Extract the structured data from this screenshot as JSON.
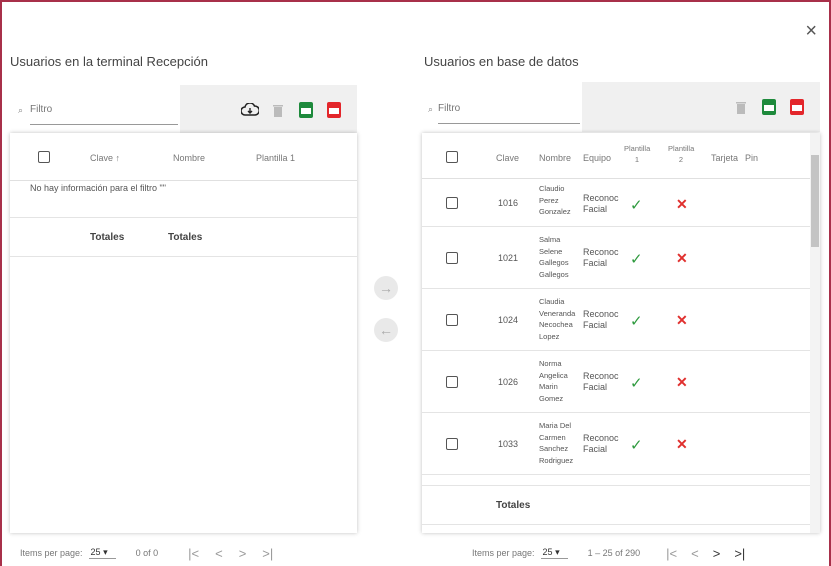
{
  "dialog": {
    "close_label": "×"
  },
  "left": {
    "title": "Usuarios en la terminal Recepción",
    "filter_placeholder": "Filtro",
    "columns": {
      "clave": "Clave ↑",
      "nombre": "Nombre",
      "plantilla1": "Plantilla 1"
    },
    "empty_message": "No hay información para el filtro \"\"",
    "totals": [
      "Totales",
      "Totales"
    ],
    "footer": {
      "items_per_page_label": "Items per page:",
      "page_size": "25",
      "range": "0 of 0"
    }
  },
  "transfer": {
    "right_arrow": "→",
    "left_arrow": "←"
  },
  "right": {
    "title": "Usuarios en base de datos",
    "filter_placeholder": "Filtro",
    "columns": {
      "clave": "Clave",
      "nombre": "Nombre",
      "equipo": "Equipo",
      "plantilla1": "Plantilla 1",
      "plantilla2": "Plantilla 2",
      "tarjeta": "Tarjeta",
      "pin": "Pin"
    },
    "rows": [
      {
        "clave": "1016",
        "nombre": [
          "Claudio",
          "Perez",
          "Gonzalez"
        ],
        "equipo": [
          "Reconoc",
          "Facial"
        ],
        "plantilla1": "✓",
        "plantilla2": "✕"
      },
      {
        "clave": "1021",
        "nombre": [
          "Salma",
          "Selene",
          "Gallegos",
          "Gallegos"
        ],
        "equipo": [
          "Reconoc",
          "Facial"
        ],
        "plantilla1": "✓",
        "plantilla2": "✕"
      },
      {
        "clave": "1024",
        "nombre": [
          "Claudia",
          "Veneranda",
          "Necochea",
          "Lopez"
        ],
        "equipo": [
          "Reconoc",
          "Facial"
        ],
        "plantilla1": "✓",
        "plantilla2": "✕"
      },
      {
        "clave": "1026",
        "nombre": [
          "Norma",
          "Angelica",
          "Marin",
          "Gomez"
        ],
        "equipo": [
          "Reconoc",
          "Facial"
        ],
        "plantilla1": "✓",
        "plantilla2": "✕"
      },
      {
        "clave": "1033",
        "nombre": [
          "Maria Del",
          "Carmen",
          "Sanchez",
          "Rodriguez"
        ],
        "equipo": [
          "Reconoc",
          "Facial"
        ],
        "plantilla1": "✓",
        "plantilla2": "✕"
      }
    ],
    "totals": "Totales",
    "footer": {
      "items_per_page_label": "Items per page:",
      "page_size": "25",
      "range": "1 – 25 of 290"
    }
  },
  "pager": {
    "first": "|<",
    "prev": "<",
    "next": ">",
    "last": ">|"
  },
  "colors": {
    "border": "#a8304a",
    "check": "#2e9a3e",
    "cross": "#e0302e",
    "excel": "#1e8a3c",
    "pdf": "#e3262b"
  }
}
